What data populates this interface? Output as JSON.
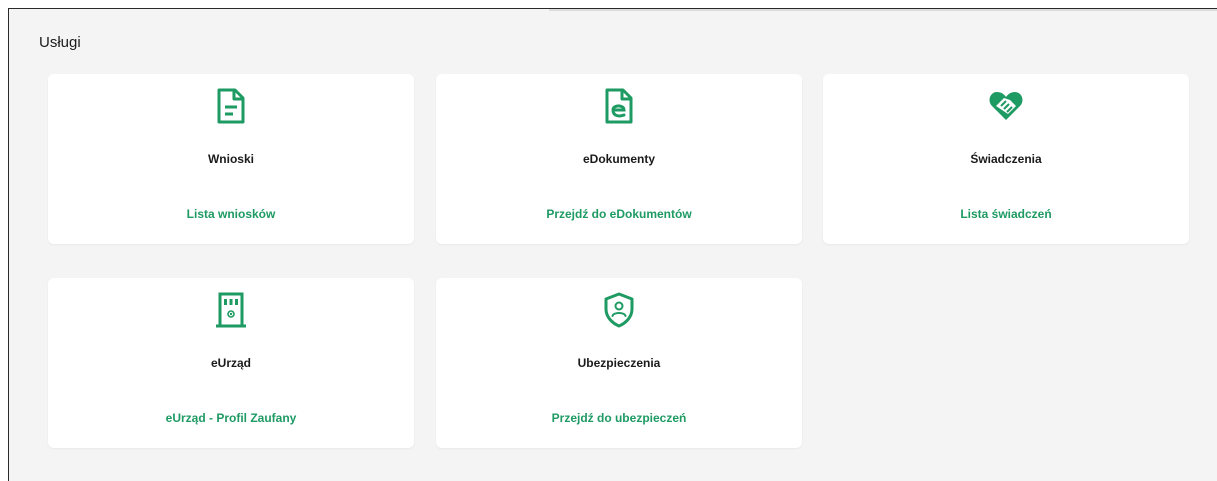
{
  "section": {
    "title": "Usługi"
  },
  "colors": {
    "accent": "#1e9a63",
    "card_background": "#ffffff",
    "page_background": "#f4f4f4",
    "text": "#1b1b1b"
  },
  "cards": [
    {
      "title": "Wnioski",
      "link": "Lista wniosków",
      "icon": "document-icon"
    },
    {
      "title": "eDokumenty",
      "link": "Przejdź do eDokumentów",
      "icon": "edocument-icon"
    },
    {
      "title": "Świadczenia",
      "link": "Lista świadczeń",
      "icon": "heart-handshake-icon"
    },
    {
      "title": "eUrząd",
      "link": "eUrząd - Profil Zaufany",
      "icon": "e-office-icon"
    },
    {
      "title": "Ubezpieczenia",
      "link": "Przejdź do ubezpieczeń",
      "icon": "shield-user-icon"
    }
  ]
}
